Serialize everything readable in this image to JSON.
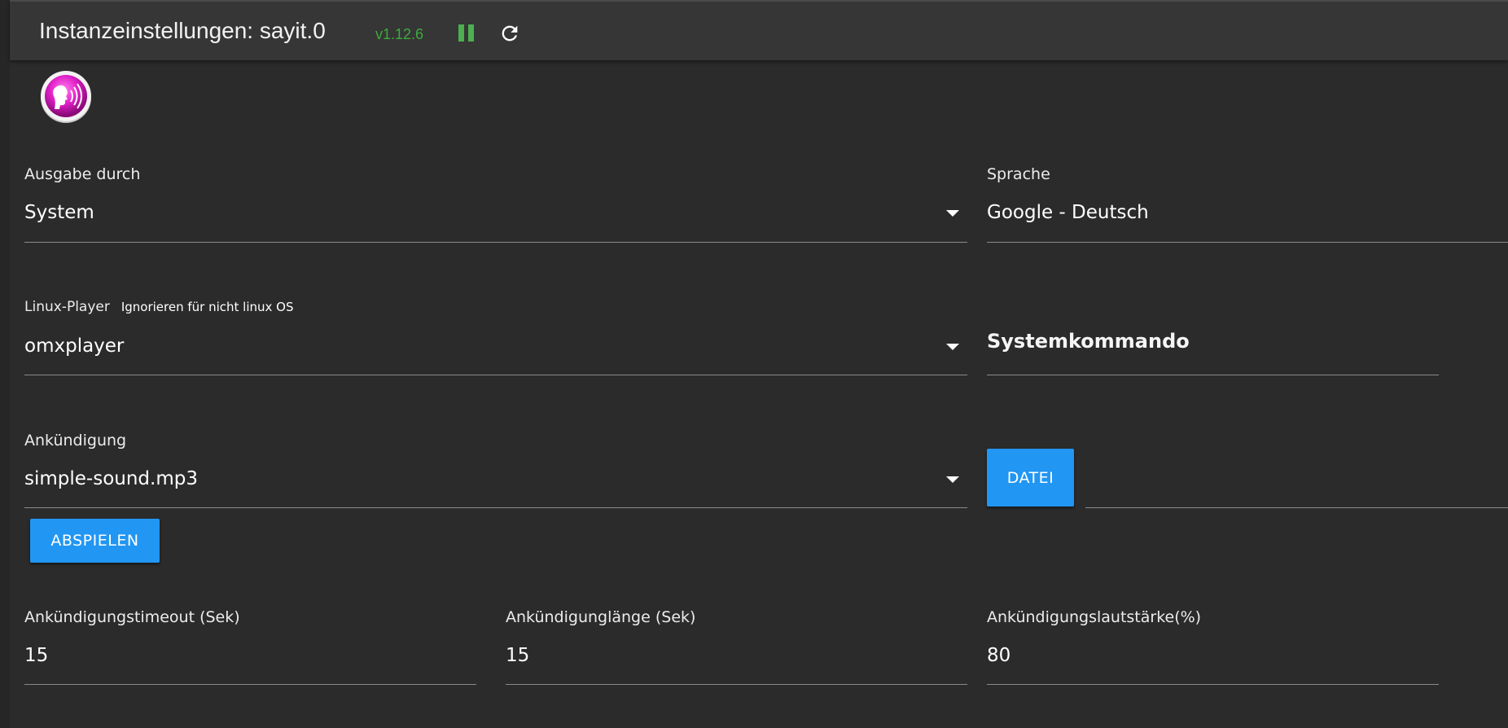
{
  "header": {
    "title": "Instanzeinstellungen: sayit.0",
    "version": "v1.12.6",
    "pause_icon": "pause-icon",
    "reload_icon": "reload-icon",
    "version_color": "#3cab3c",
    "pause_color": "#4caf50"
  },
  "logo": {
    "icon": "sayit-logo"
  },
  "fields": {
    "ausgabe": {
      "label": "Ausgabe durch",
      "value": "System"
    },
    "sprache": {
      "label": "Sprache",
      "value": "Google - Deutsch"
    },
    "linux_player": {
      "label": "Linux-Player",
      "hint": "Ignorieren für nicht linux OS",
      "value": "omxplayer"
    },
    "systemkommando": {
      "placeholder": "Systemkommando"
    },
    "ankuendigung": {
      "label": "Ankündigung",
      "value": "simple-sound.mp3"
    },
    "timeout": {
      "label": "Ankündigungstimeout (Sek)",
      "value": "15"
    },
    "laenge": {
      "label": "Ankündigunglänge (Sek)",
      "value": "15"
    },
    "lautstaerke": {
      "label": "Ankündigungslautstärke(%)",
      "value": "80"
    }
  },
  "buttons": {
    "datei": "DATEI",
    "abspielen": "ABSPIELEN",
    "accent": "#2196f3"
  }
}
